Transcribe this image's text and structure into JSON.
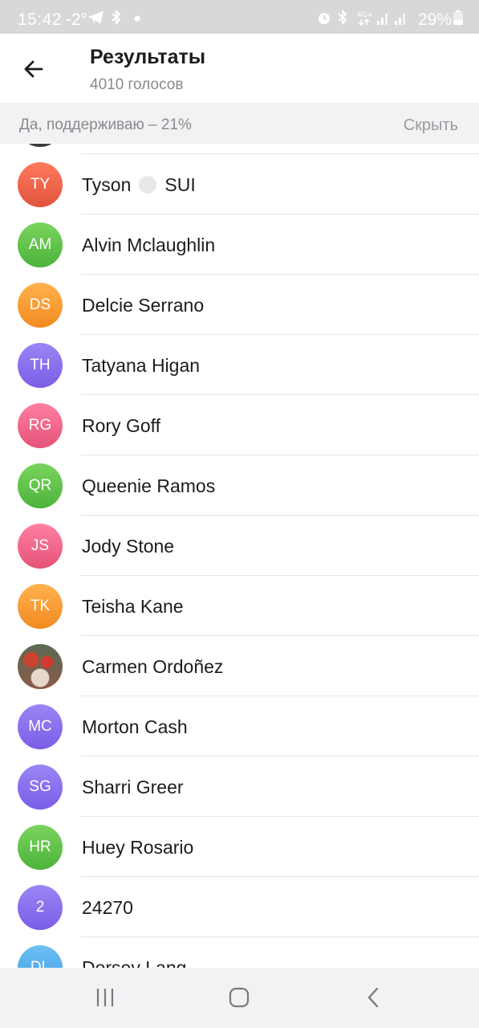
{
  "status_bar": {
    "time": "15:42",
    "temperature": "-2°",
    "battery": "29%",
    "icons": [
      "telegram-icon",
      "bluetooth-icon",
      "dot-icon",
      "alarm-icon",
      "bluetooth-icon",
      "4g-icon",
      "signal-icon",
      "signal-icon",
      "battery-icon"
    ]
  },
  "header": {
    "title": "Результаты",
    "subtitle": "4010 голосов",
    "back_icon": "arrow-left-icon"
  },
  "section": {
    "label": "Да, поддерживаю – 21%",
    "hide_label": "Скрыть"
  },
  "voters": [
    {
      "initials": "TY",
      "name": "Tyson",
      "suffix": "SUI",
      "color": "red"
    },
    {
      "initials": "AM",
      "name": "Alvin Mclaughlin",
      "color": "green"
    },
    {
      "initials": "DS",
      "name": "Delcie Serrano",
      "color": "orange"
    },
    {
      "initials": "TH",
      "name": "Tatyana Higan",
      "color": "violet"
    },
    {
      "initials": "RG",
      "name": "Rory Goff",
      "color": "pink"
    },
    {
      "initials": "QR",
      "name": "Queenie Ramos",
      "color": "green"
    },
    {
      "initials": "JS",
      "name": "Jody Stone",
      "color": "pink"
    },
    {
      "initials": "TK",
      "name": "Teisha Kane",
      "color": "orange"
    },
    {
      "initials": "",
      "name": "Carmen Ordoñez",
      "color": "photo"
    },
    {
      "initials": "MC",
      "name": "Morton Cash",
      "color": "violet"
    },
    {
      "initials": "SG",
      "name": "Sharri Greer",
      "color": "violet"
    },
    {
      "initials": "HR",
      "name": "Huey Rosario",
      "color": "green"
    },
    {
      "initials": "2",
      "name": "24270",
      "color": "violet"
    },
    {
      "initials": "DL",
      "name": "Dorsey Lang",
      "color": "blue"
    }
  ],
  "nav": {
    "recents_icon": "recents-icon",
    "home_icon": "home-icon",
    "back_icon": "back-chevron-icon"
  }
}
